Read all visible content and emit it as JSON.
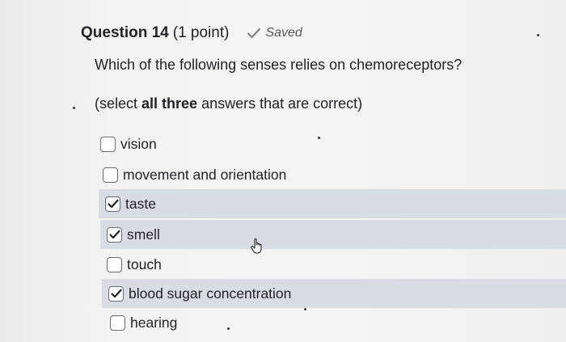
{
  "question": {
    "title": "Question 14",
    "points": "(1 point)",
    "status": "Saved",
    "status_icon": "checkmark-icon",
    "prompt": "Which of the following senses relies on chemoreceptors?",
    "instruction_prefix": "(select ",
    "instruction_emphasis": "all three",
    "instruction_suffix": " answers that are correct)"
  },
  "options": [
    {
      "label": "vision",
      "checked": false
    },
    {
      "label": "movement and orientation",
      "checked": false
    },
    {
      "label": "taste",
      "checked": true
    },
    {
      "label": "smell",
      "checked": true
    },
    {
      "label": "touch",
      "checked": false
    },
    {
      "label": "blood sugar concentration",
      "checked": true
    },
    {
      "label": "hearing",
      "checked": false
    }
  ],
  "colors": {
    "selected_row_bg": "#d9dde3",
    "checkbox_border": "#6a6c70",
    "text": "#222327"
  }
}
